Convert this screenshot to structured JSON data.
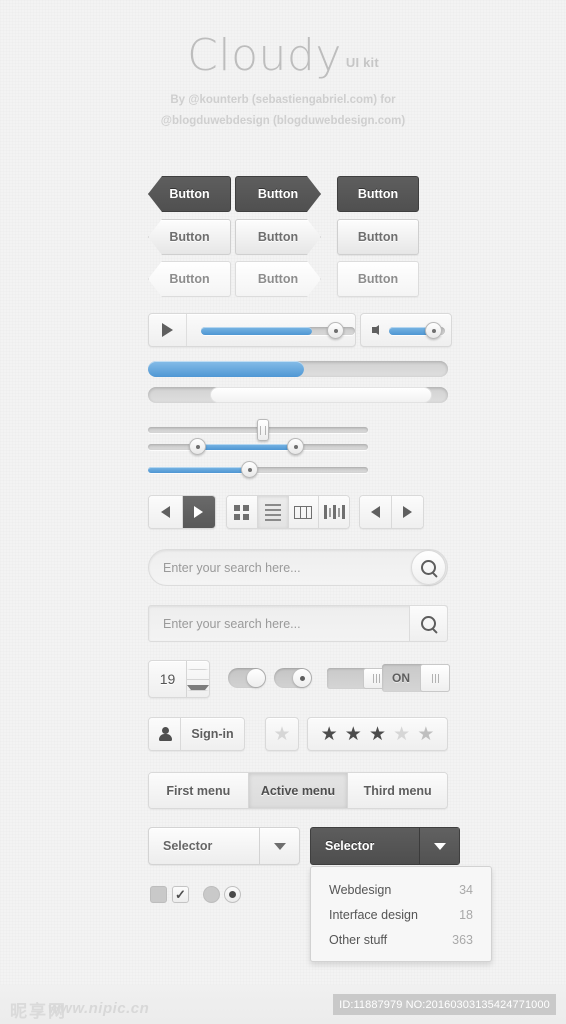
{
  "header": {
    "title": "Cloudy",
    "subtitle": "UI kit",
    "credit_line1": "By @kounterb (sebastiengabriel.com) for",
    "credit_line2": "@blogduwebdesign (blogduwebdesign.com)"
  },
  "colors": {
    "background": "#f3f3f3",
    "accent_blue": "#5b9fd8",
    "dark_button": "#565656",
    "text_gray": "#6e6e6e",
    "track_gray": "#d2d2d2"
  },
  "buttons": {
    "label": "Button",
    "rows": [
      {
        "style": "dark",
        "shapes": [
          "arr-left",
          "arr-right",
          "rect"
        ]
      },
      {
        "style": "light",
        "shapes": [
          "arr-left",
          "arr-right",
          "rect"
        ]
      },
      {
        "style": "lightest",
        "shapes": [
          "arr-left",
          "arr-right",
          "rect"
        ]
      }
    ]
  },
  "media": {
    "play_icon": "play-icon",
    "volume_icon": "speaker-icon",
    "progress_percent": 72,
    "volume_percent": 78
  },
  "progress_bars": [
    {
      "name": "blue-progress",
      "percent": 52,
      "fill": "blue"
    },
    {
      "name": "white-progress",
      "percent": 78,
      "fill": "white"
    }
  ],
  "sliders": [
    {
      "name": "square-handle-slider",
      "type": "single",
      "value": 52
    },
    {
      "name": "range-slider",
      "type": "range",
      "low": 22,
      "high": 67
    },
    {
      "name": "fill-slider",
      "type": "single",
      "value": 46
    }
  ],
  "toolbar": {
    "prev_icon": "triangle-left-icon",
    "next_icon": "triangle-right-icon",
    "views": [
      {
        "name": "grid-view-icon",
        "icon": "grid-icon",
        "active": false
      },
      {
        "name": "list-view-icon",
        "icon": "list-icon",
        "active": true
      },
      {
        "name": "column-view-icon",
        "icon": "columns-icon",
        "active": false
      },
      {
        "name": "flow-view-icon",
        "icon": "coverflow-icon",
        "active": false
      }
    ],
    "pager_prev_icon": "triangle-left-icon",
    "pager_next_icon": "triangle-right-icon"
  },
  "search": {
    "rounded": {
      "placeholder": "Enter your search here...",
      "value": "",
      "icon": "search-icon"
    },
    "squared": {
      "placeholder": "Enter your search here...",
      "value": "",
      "icon": "search-icon"
    }
  },
  "stepper": {
    "value": "19",
    "up_icon": "caret-up-icon",
    "down_icon": "caret-down-icon"
  },
  "toggles": [
    {
      "name": "pill-toggle-off",
      "state": "off",
      "marked": false
    },
    {
      "name": "pill-toggle-on",
      "state": "on",
      "marked": true
    },
    {
      "name": "slide-switch-plain",
      "label": "",
      "state": "on"
    },
    {
      "name": "slide-switch-on",
      "label": "ON",
      "state": "on"
    }
  ],
  "signin": {
    "label": "Sign-in",
    "icon": "person-icon"
  },
  "rating": {
    "single_star": {
      "filled": false
    },
    "stars": [
      true,
      true,
      true,
      false,
      false
    ],
    "star_glyph": "★"
  },
  "menus": [
    {
      "label": "First menu",
      "active": false
    },
    {
      "label": "Active menu",
      "active": true
    },
    {
      "label": "Third menu",
      "active": false
    }
  ],
  "selectors": [
    {
      "label": "Selector",
      "style": "light",
      "icon": "caret-down-icon"
    },
    {
      "label": "Selector",
      "style": "dark",
      "icon": "caret-down-icon"
    }
  ],
  "dropdown": {
    "items": [
      {
        "label": "Webdesign",
        "count": "34"
      },
      {
        "label": "Interface design",
        "count": "18"
      },
      {
        "label": "Other stuff",
        "count": "363"
      }
    ]
  },
  "checks": [
    {
      "name": "checkbox-unchecked",
      "type": "checkbox",
      "checked": false
    },
    {
      "name": "checkbox-checked",
      "type": "checkbox",
      "checked": true,
      "glyph": "✓"
    },
    {
      "name": "radio-unselected",
      "type": "radio",
      "checked": false
    },
    {
      "name": "radio-selected",
      "type": "radio",
      "checked": true
    }
  ],
  "footer": {
    "watermark_cn": "昵享网",
    "watermark_url": "www.nipic.cn",
    "id_text": "ID:11887979 NO:20160303135424771000"
  }
}
